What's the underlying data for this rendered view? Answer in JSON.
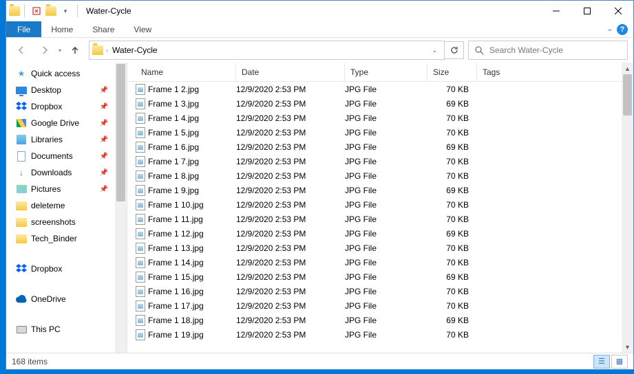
{
  "title": "Water-Cycle",
  "ribbon": {
    "file": "File",
    "home": "Home",
    "share": "Share",
    "view": "View"
  },
  "address": {
    "folder": "Water-Cycle",
    "sep": "›"
  },
  "search": {
    "placeholder": "Search Water-Cycle"
  },
  "nav": {
    "quick_access": "Quick access",
    "desktop": "Desktop",
    "dropbox": "Dropbox",
    "gdrive": "Google Drive",
    "libraries": "Libraries",
    "documents": "Documents",
    "downloads": "Downloads",
    "pictures": "Pictures",
    "deleteme": "deleteme",
    "screenshots": "screenshots",
    "tech_binder": "Tech_Binder",
    "dropbox2": "Dropbox",
    "onedrive": "OneDrive",
    "this_pc": "This PC"
  },
  "cols": {
    "name": "Name",
    "date": "Date",
    "type": "Type",
    "size": "Size",
    "tags": "Tags"
  },
  "files": [
    {
      "name": "Frame 1 2.jpg",
      "date": "12/9/2020 2:53 PM",
      "type": "JPG File",
      "size": "70 KB"
    },
    {
      "name": "Frame 1 3.jpg",
      "date": "12/9/2020 2:53 PM",
      "type": "JPG File",
      "size": "69 KB"
    },
    {
      "name": "Frame 1 4.jpg",
      "date": "12/9/2020 2:53 PM",
      "type": "JPG File",
      "size": "70 KB"
    },
    {
      "name": "Frame 1 5.jpg",
      "date": "12/9/2020 2:53 PM",
      "type": "JPG File",
      "size": "70 KB"
    },
    {
      "name": "Frame 1 6.jpg",
      "date": "12/9/2020 2:53 PM",
      "type": "JPG File",
      "size": "69 KB"
    },
    {
      "name": "Frame 1 7.jpg",
      "date": "12/9/2020 2:53 PM",
      "type": "JPG File",
      "size": "70 KB"
    },
    {
      "name": "Frame 1 8.jpg",
      "date": "12/9/2020 2:53 PM",
      "type": "JPG File",
      "size": "70 KB"
    },
    {
      "name": "Frame 1 9.jpg",
      "date": "12/9/2020 2:53 PM",
      "type": "JPG File",
      "size": "69 KB"
    },
    {
      "name": "Frame 1 10.jpg",
      "date": "12/9/2020 2:53 PM",
      "type": "JPG File",
      "size": "70 KB"
    },
    {
      "name": "Frame 1 11.jpg",
      "date": "12/9/2020 2:53 PM",
      "type": "JPG File",
      "size": "70 KB"
    },
    {
      "name": "Frame 1 12.jpg",
      "date": "12/9/2020 2:53 PM",
      "type": "JPG File",
      "size": "69 KB"
    },
    {
      "name": "Frame 1 13.jpg",
      "date": "12/9/2020 2:53 PM",
      "type": "JPG File",
      "size": "70 KB"
    },
    {
      "name": "Frame 1 14.jpg",
      "date": "12/9/2020 2:53 PM",
      "type": "JPG File",
      "size": "70 KB"
    },
    {
      "name": "Frame 1 15.jpg",
      "date": "12/9/2020 2:53 PM",
      "type": "JPG File",
      "size": "69 KB"
    },
    {
      "name": "Frame 1 16.jpg",
      "date": "12/9/2020 2:53 PM",
      "type": "JPG File",
      "size": "70 KB"
    },
    {
      "name": "Frame 1 17.jpg",
      "date": "12/9/2020 2:53 PM",
      "type": "JPG File",
      "size": "70 KB"
    },
    {
      "name": "Frame 1 18.jpg",
      "date": "12/9/2020 2:53 PM",
      "type": "JPG File",
      "size": "69 KB"
    },
    {
      "name": "Frame 1 19.jpg",
      "date": "12/9/2020 2:53 PM",
      "type": "JPG File",
      "size": "70 KB"
    }
  ],
  "status": {
    "count": "168 items"
  }
}
